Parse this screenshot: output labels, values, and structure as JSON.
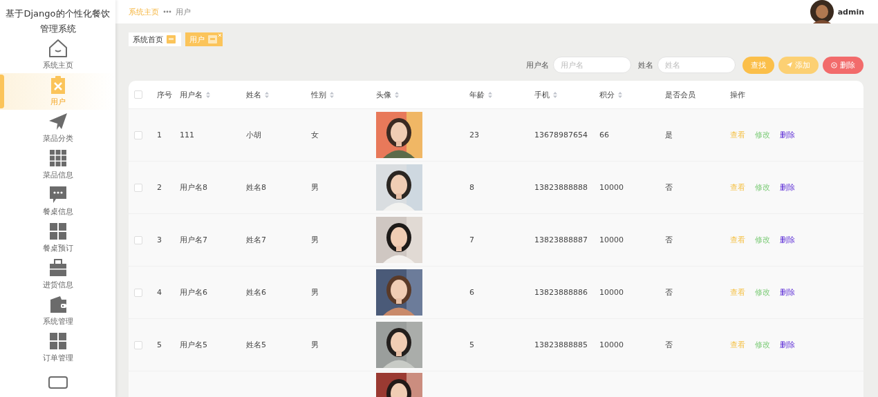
{
  "sidebar": {
    "title": "基于Django的个性化餐饮管理系统",
    "items": [
      {
        "label": "系统主页",
        "kind": "home",
        "selected": false
      },
      {
        "label": "用户",
        "kind": "clipboard",
        "selected": true
      },
      {
        "label": "菜品分类",
        "kind": "plane",
        "selected": false
      },
      {
        "label": "菜品信息",
        "kind": "grid9",
        "selected": false
      },
      {
        "label": "餐桌信息",
        "kind": "chat",
        "selected": false
      },
      {
        "label": "餐桌预订",
        "kind": "grid4",
        "selected": false
      },
      {
        "label": "进货信息",
        "kind": "briefcase",
        "selected": false
      },
      {
        "label": "系统管理",
        "kind": "wallet",
        "selected": false
      },
      {
        "label": "订单管理",
        "kind": "grid4",
        "selected": false
      },
      {
        "kind": "card",
        "selected": false
      }
    ]
  },
  "breadcrumb": [
    {
      "label": "系统主页",
      "selected": false
    },
    {
      "label": "用户",
      "selected": true
    }
  ],
  "user": {
    "name": "admin"
  },
  "tabs": [
    {
      "label": "系统首页",
      "selected": false,
      "closable": false
    },
    {
      "label": "用户",
      "selected": true,
      "closable": true
    }
  ],
  "search": {
    "fields": [
      {
        "label": "用户名",
        "placeholder": "用户名"
      },
      {
        "label": "姓名",
        "placeholder": "姓名"
      }
    ],
    "buttons": [
      {
        "label": "查找",
        "kind": "search"
      },
      {
        "label": "添加",
        "kind": "add"
      },
      {
        "label": "删除",
        "kind": "delete"
      }
    ]
  },
  "table": {
    "select_all": {
      "checked": false
    },
    "columns": [
      {
        "label": "序号",
        "sortable": false
      },
      {
        "label": "用户名",
        "sortable": true
      },
      {
        "label": "姓名",
        "sortable": true
      },
      {
        "label": "性别",
        "sortable": true
      },
      {
        "label": "头像",
        "sortable": true
      },
      {
        "label": "年龄",
        "sortable": true
      },
      {
        "label": "手机",
        "sortable": true
      },
      {
        "label": "积分",
        "sortable": true
      },
      {
        "label": "是否会员",
        "sortable": false
      },
      {
        "label": "操作",
        "sortable": false
      }
    ],
    "rows": [
      {
        "kind": "full",
        "checked": false,
        "index": "1",
        "username": "111",
        "name": "小胡",
        "gender": "女",
        "age": "23",
        "phone": "13678987654",
        "points": "66",
        "member": "是",
        "actions": [
          "查看",
          "修改",
          "删除"
        ]
      },
      {
        "kind": "full",
        "checked": false,
        "index": "2",
        "username": "用户名8",
        "name": "姓名8",
        "gender": "男",
        "age": "8",
        "phone": "13823888888",
        "points": "10000",
        "member": "否",
        "actions": [
          "查看",
          "修改",
          "删除"
        ]
      },
      {
        "kind": "full",
        "checked": false,
        "index": "3",
        "username": "用户名7",
        "name": "姓名7",
        "gender": "男",
        "age": "7",
        "phone": "13823888887",
        "points": "10000",
        "member": "否",
        "actions": [
          "查看",
          "修改",
          "删除"
        ]
      },
      {
        "kind": "full",
        "checked": false,
        "index": "4",
        "username": "用户名6",
        "name": "姓名6",
        "gender": "男",
        "age": "6",
        "phone": "13823888886",
        "points": "10000",
        "member": "否",
        "actions": [
          "查看",
          "修改",
          "删除"
        ]
      },
      {
        "kind": "full",
        "checked": false,
        "index": "5",
        "username": "用户名5",
        "name": "姓名5",
        "gender": "男",
        "age": "5",
        "phone": "13823888885",
        "points": "10000",
        "member": "否",
        "actions": [
          "查看",
          "修改",
          "删除"
        ]
      },
      {
        "kind": "partial"
      }
    ]
  }
}
